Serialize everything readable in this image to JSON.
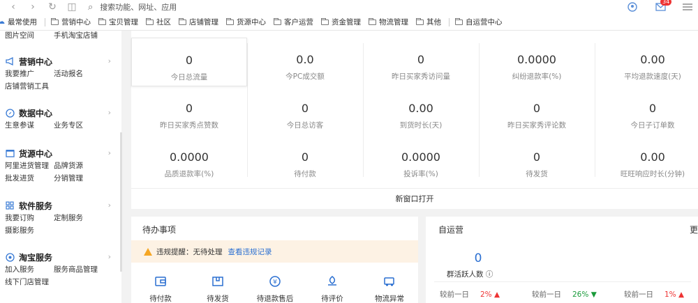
{
  "browser": {
    "search_placeholder": "搜索功能、网址、应用",
    "mail_badge": "34"
  },
  "bookmarks": [
    "最常使用",
    "营销中心",
    "宝贝管理",
    "社区",
    "店铺管理",
    "货源中心",
    "客户运营",
    "资金管理",
    "物流管理",
    "其他",
    "自运营中心"
  ],
  "sidebar": {
    "top_items": [
      "图片空间",
      "手机淘宝店铺"
    ],
    "groups": [
      {
        "title": "营销中心",
        "rows": [
          [
            "我要推广",
            "活动报名"
          ],
          [
            "店铺营销工具"
          ]
        ]
      },
      {
        "title": "数据中心",
        "rows": [
          [
            "生意参谋",
            "业务专区"
          ]
        ]
      },
      {
        "title": "货源中心",
        "rows": [
          [
            "阿里进货管理",
            "品牌货源"
          ],
          [
            "批发进货",
            "分销管理"
          ]
        ]
      },
      {
        "title": "软件服务",
        "rows": [
          [
            "我要订购",
            "定制服务"
          ],
          [
            "摄影服务"
          ]
        ]
      },
      {
        "title": "淘宝服务",
        "rows": [
          [
            "加入服务",
            "服务商品管理"
          ],
          [
            "线下门店管理"
          ]
        ]
      }
    ]
  },
  "stats": [
    {
      "value": "0",
      "label": "今日总流量"
    },
    {
      "value": "0.0",
      "label": "今PC成交额"
    },
    {
      "value": "0",
      "label": "昨日买家秀访问量"
    },
    {
      "value": "0.0000",
      "label": "纠纷退款率(%)"
    },
    {
      "value": "0.00",
      "label": "平均退款速度(天)"
    },
    {
      "value": "0",
      "label": "昨日买家秀点赞数"
    },
    {
      "value": "0",
      "label": "今日总访客"
    },
    {
      "value": "0.00",
      "label": "到货时长(天)"
    },
    {
      "value": "0",
      "label": "昨日买家秀评论数"
    },
    {
      "value": "0",
      "label": "今日子订单数"
    },
    {
      "value": "0.0000",
      "label": "品质退款率(%)"
    },
    {
      "value": "0",
      "label": "待付款"
    },
    {
      "value": "0.0000",
      "label": "投诉率(%)"
    },
    {
      "value": "0",
      "label": "待发货"
    },
    {
      "value": "0.00",
      "label": "旺旺响应时长(分钟)"
    }
  ],
  "new_window": "新窗口打开",
  "todo": {
    "title": "待办事项",
    "alert_text": "违规提醒：无待处理",
    "alert_link": "查看违规记录",
    "items": [
      "待付款",
      "待发货",
      "待退款售后",
      "待评价",
      "物流异常"
    ]
  },
  "self_op": {
    "title": "自运营",
    "more": "更",
    "value": "0",
    "label": "群活跃人数",
    "compare_label": "较前一日",
    "compare": [
      {
        "pct": "2%",
        "dir": "up"
      },
      {
        "pct": "26%",
        "dir": "down"
      },
      {
        "pct": "1%",
        "dir": "up"
      }
    ]
  }
}
